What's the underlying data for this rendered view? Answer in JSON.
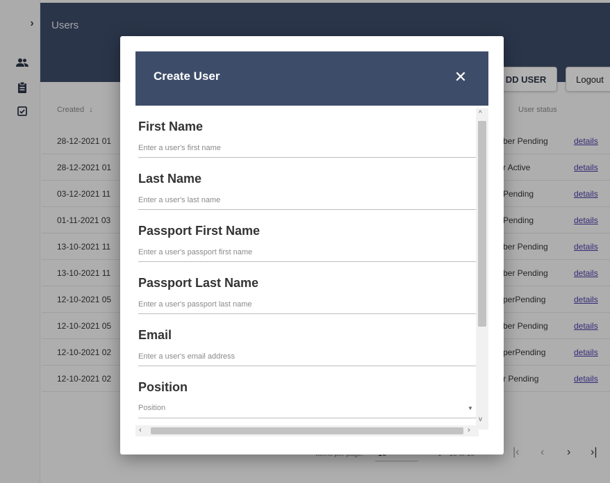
{
  "header": {
    "title": "Users"
  },
  "page_buttons": {
    "add_user": "DD USER",
    "logout": "Logout"
  },
  "table": {
    "headers": {
      "created": "Created",
      "sort_icon": "↓",
      "user_status": "User status"
    },
    "rows": [
      {
        "created": "28-12-2021 01",
        "status": "ber Pending",
        "details": "details"
      },
      {
        "created": "28-12-2021 01",
        "status": "r   Active",
        "details": "details"
      },
      {
        "created": "03-12-2021 11",
        "status": "Pending",
        "details": "details"
      },
      {
        "created": "01-11-2021 03",
        "status": "Pending",
        "details": "details"
      },
      {
        "created": "13-10-2021 11",
        "status": "ber Pending",
        "details": "details"
      },
      {
        "created": "13-10-2021 11",
        "status": "ber Pending",
        "details": "details"
      },
      {
        "created": "12-10-2021 05",
        "status": "perPending",
        "details": "details"
      },
      {
        "created": "12-10-2021 05",
        "status": "ber Pending",
        "details": "details"
      },
      {
        "created": "12-10-2021 02",
        "status": "perPending",
        "details": "details"
      },
      {
        "created": "12-10-2021 02",
        "status": "r   Pending",
        "details": "details"
      }
    ]
  },
  "paginator": {
    "items_per_page_label": "Items per page:",
    "page_size": "10",
    "range": "1 – 10 of 16"
  },
  "dialog": {
    "title": "Create User",
    "close_glyph": "✕",
    "fields": [
      {
        "label": "First Name",
        "placeholder": "Enter a user's first name"
      },
      {
        "label": "Last Name",
        "placeholder": "Enter a user's last name"
      },
      {
        "label": "Passport First Name",
        "placeholder": "Enter a user's passport first name"
      },
      {
        "label": "Passport Last Name",
        "placeholder": "Enter a user's passport last name"
      },
      {
        "label": "Email",
        "placeholder": "Enter a user's email address"
      }
    ],
    "position": {
      "label": "Position",
      "placeholder": "Position"
    }
  },
  "icons": {
    "rail_chevron": "chevron-right-icon",
    "rail_users": "users-icon",
    "rail_clipboard": "clipboard-icon",
    "rail_checkbox": "checkbox-icon"
  },
  "colors": {
    "header_bg": "#3d4d69",
    "link": "#4a3ca8"
  }
}
